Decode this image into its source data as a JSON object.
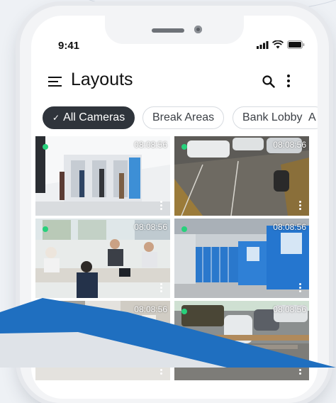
{
  "status_bar": {
    "time": "9:41"
  },
  "header": {
    "title": "Layouts"
  },
  "chips": [
    {
      "label": "All Cameras",
      "selected": true
    },
    {
      "label": "Break Areas",
      "selected": false
    },
    {
      "label": "Bank Lobby",
      "selected": false
    },
    {
      "label": "A",
      "selected": false
    }
  ],
  "tiles": [
    {
      "timestamp": "08:08:56",
      "scene": "bank-lobby-atms"
    },
    {
      "timestamp": "08:08:56",
      "scene": "parking-lot-cars"
    },
    {
      "timestamp": "08:08:56",
      "scene": "office-meeting"
    },
    {
      "timestamp": "08:08:56",
      "scene": "kiosk-row"
    },
    {
      "timestamp": "08:08:56",
      "scene": "hallway"
    },
    {
      "timestamp": "08:08:56",
      "scene": "street-parking"
    }
  ],
  "colors": {
    "accent": "#2f343b",
    "live": "#27d17c",
    "brand_blue": "#1f6fc0"
  }
}
